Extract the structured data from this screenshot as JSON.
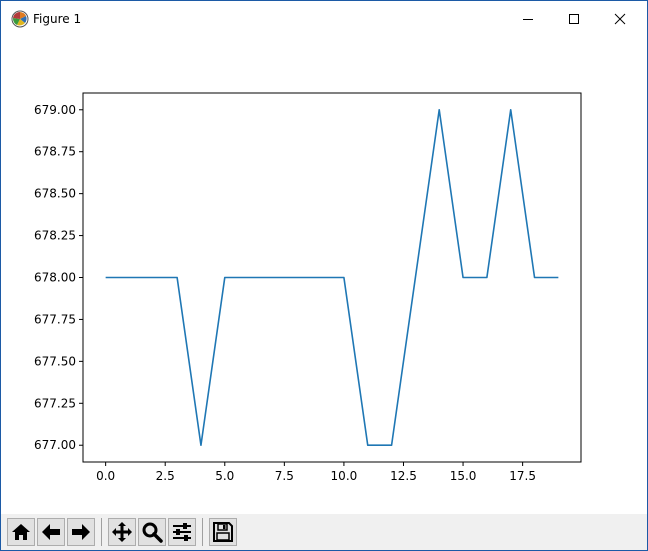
{
  "window": {
    "title": "Figure 1",
    "icons": {
      "app": "matplotlib-icon",
      "minimize": "minimize-icon",
      "maximize": "maximize-icon",
      "close": "close-icon"
    }
  },
  "colors": {
    "line": "#1f77b4",
    "axis": "#000000",
    "toolbar_bg": "#f0f0f0",
    "frame": "#1c5aa6"
  },
  "toolbar": {
    "buttons": [
      {
        "id": "home",
        "icon": "home-icon"
      },
      {
        "id": "back",
        "icon": "arrow-left-icon"
      },
      {
        "id": "forward",
        "icon": "arrow-right-icon"
      },
      {
        "id": "pan",
        "icon": "move-icon"
      },
      {
        "id": "zoom",
        "icon": "magnifier-icon"
      },
      {
        "id": "configure",
        "icon": "sliders-icon"
      },
      {
        "id": "save",
        "icon": "floppy-disk-icon"
      }
    ]
  },
  "chart_data": {
    "type": "line",
    "x": [
      0,
      1,
      2,
      3,
      4,
      5,
      6,
      7,
      8,
      9,
      10,
      11,
      12,
      13,
      14,
      15,
      16,
      17,
      18,
      19
    ],
    "series": [
      {
        "values": [
          678,
          678,
          678,
          678,
          677,
          678,
          678,
          678,
          678,
          678,
          678,
          677,
          677,
          678,
          679,
          678,
          678,
          679,
          678,
          678
        ]
      }
    ],
    "xlim": [
      -0.95,
      19.95
    ],
    "ylim": [
      676.9,
      679.1
    ],
    "xticks": [
      0.0,
      2.5,
      5.0,
      7.5,
      10.0,
      12.5,
      15.0,
      17.5
    ],
    "xtick_labels": [
      "0.0",
      "2.5",
      "5.0",
      "7.5",
      "10.0",
      "12.5",
      "15.0",
      "17.5"
    ],
    "yticks": [
      677.0,
      677.25,
      677.5,
      677.75,
      678.0,
      678.25,
      678.5,
      678.75,
      679.0
    ],
    "ytick_labels": [
      "677.00",
      "677.25",
      "677.50",
      "677.75",
      "678.00",
      "678.25",
      "678.50",
      "678.75",
      "679.00"
    ],
    "grid": false,
    "title": "",
    "xlabel": "",
    "ylabel": ""
  }
}
